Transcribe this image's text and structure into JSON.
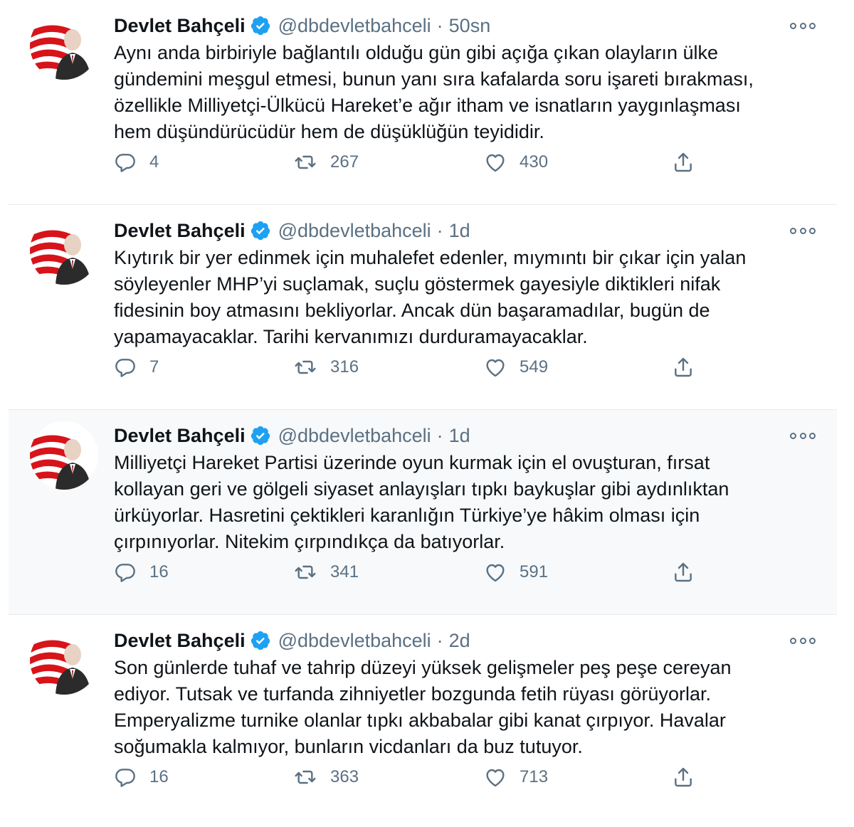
{
  "colors": {
    "text": "#0f1419",
    "secondary": "#5b7083",
    "verified": "#1da1f2",
    "hover_background": "#f7f9fa",
    "divider": "#e6ecf0",
    "avatar_red": "#d7141a"
  },
  "icons": {
    "verified": "verified-badge-icon",
    "more": "more-options-icon",
    "reply": "reply-icon",
    "retweet": "retweet-icon",
    "like": "heart-icon",
    "share": "share-icon"
  },
  "tweets": [
    {
      "author": "Devlet Bahçeli",
      "handle": "@dbdevletbahceli",
      "separator": "·",
      "time": "50sn",
      "lines": [
        "Aynı anda birbiriyle bağlantılı olduğu gün gibi açığa çıkan olayların ülke",
        "gündemini meşgul etmesi, bunun yanı sıra kafalarda soru işareti bırakması,",
        "özellikle Milliyetçi-Ülkücü Hareket’e ağır itham ve isnatların yaygınlaşması",
        "hem düşündürücüdür hem de düşüklüğün teyididir."
      ],
      "replies": "4",
      "retweets": "267",
      "likes": "430"
    },
    {
      "author": "Devlet Bahçeli",
      "handle": "@dbdevletbahceli",
      "separator": "·",
      "time": "1d",
      "lines": [
        "Kıytırık bir yer edinmek için muhalefet edenler, mıymıntı bir çıkar için yalan",
        "söyleyenler MHP’yi suçlamak, suçlu göstermek gayesiyle diktikleri nifak",
        "fidesinin boy atmasını bekliyorlar. Ancak dün başaramadılar, bugün de",
        "yapamayacaklar. Tarihi kervanımızı durduramayacaklar."
      ],
      "replies": "7",
      "retweets": "316",
      "likes": "549"
    },
    {
      "author": "Devlet Bahçeli",
      "handle": "@dbdevletbahceli",
      "separator": "·",
      "time": "1d",
      "lines": [
        "Milliyetçi Hareket Partisi üzerinde oyun kurmak için el ovuşturan, fırsat",
        "kollayan geri ve gölgeli siyaset anlayışları tıpkı baykuşlar gibi aydınlıktan",
        "ürküyorlar. Hasretini çektikleri karanlığın Türkiye’ye hâkim olması için",
        "çırpınıyorlar. Nitekim çırpındıkça da batıyorlar."
      ],
      "replies": "16",
      "retweets": "341",
      "likes": "591"
    },
    {
      "author": "Devlet Bahçeli",
      "handle": "@dbdevletbahceli",
      "separator": "·",
      "time": "2d",
      "lines": [
        "Son günlerde tuhaf ve tahrip düzeyi yüksek gelişmeler peş peşe cereyan",
        "ediyor. Tutsak ve turfanda zihniyetler bozgunda fetih rüyası görüyorlar.",
        "Emperyalizme turnike olanlar tıpkı akbabalar gibi kanat çırpıyor. Havalar",
        "soğumakla kalmıyor, bunların vicdanları da buz tutuyor."
      ],
      "replies": "16",
      "retweets": "363",
      "likes": "713"
    }
  ]
}
